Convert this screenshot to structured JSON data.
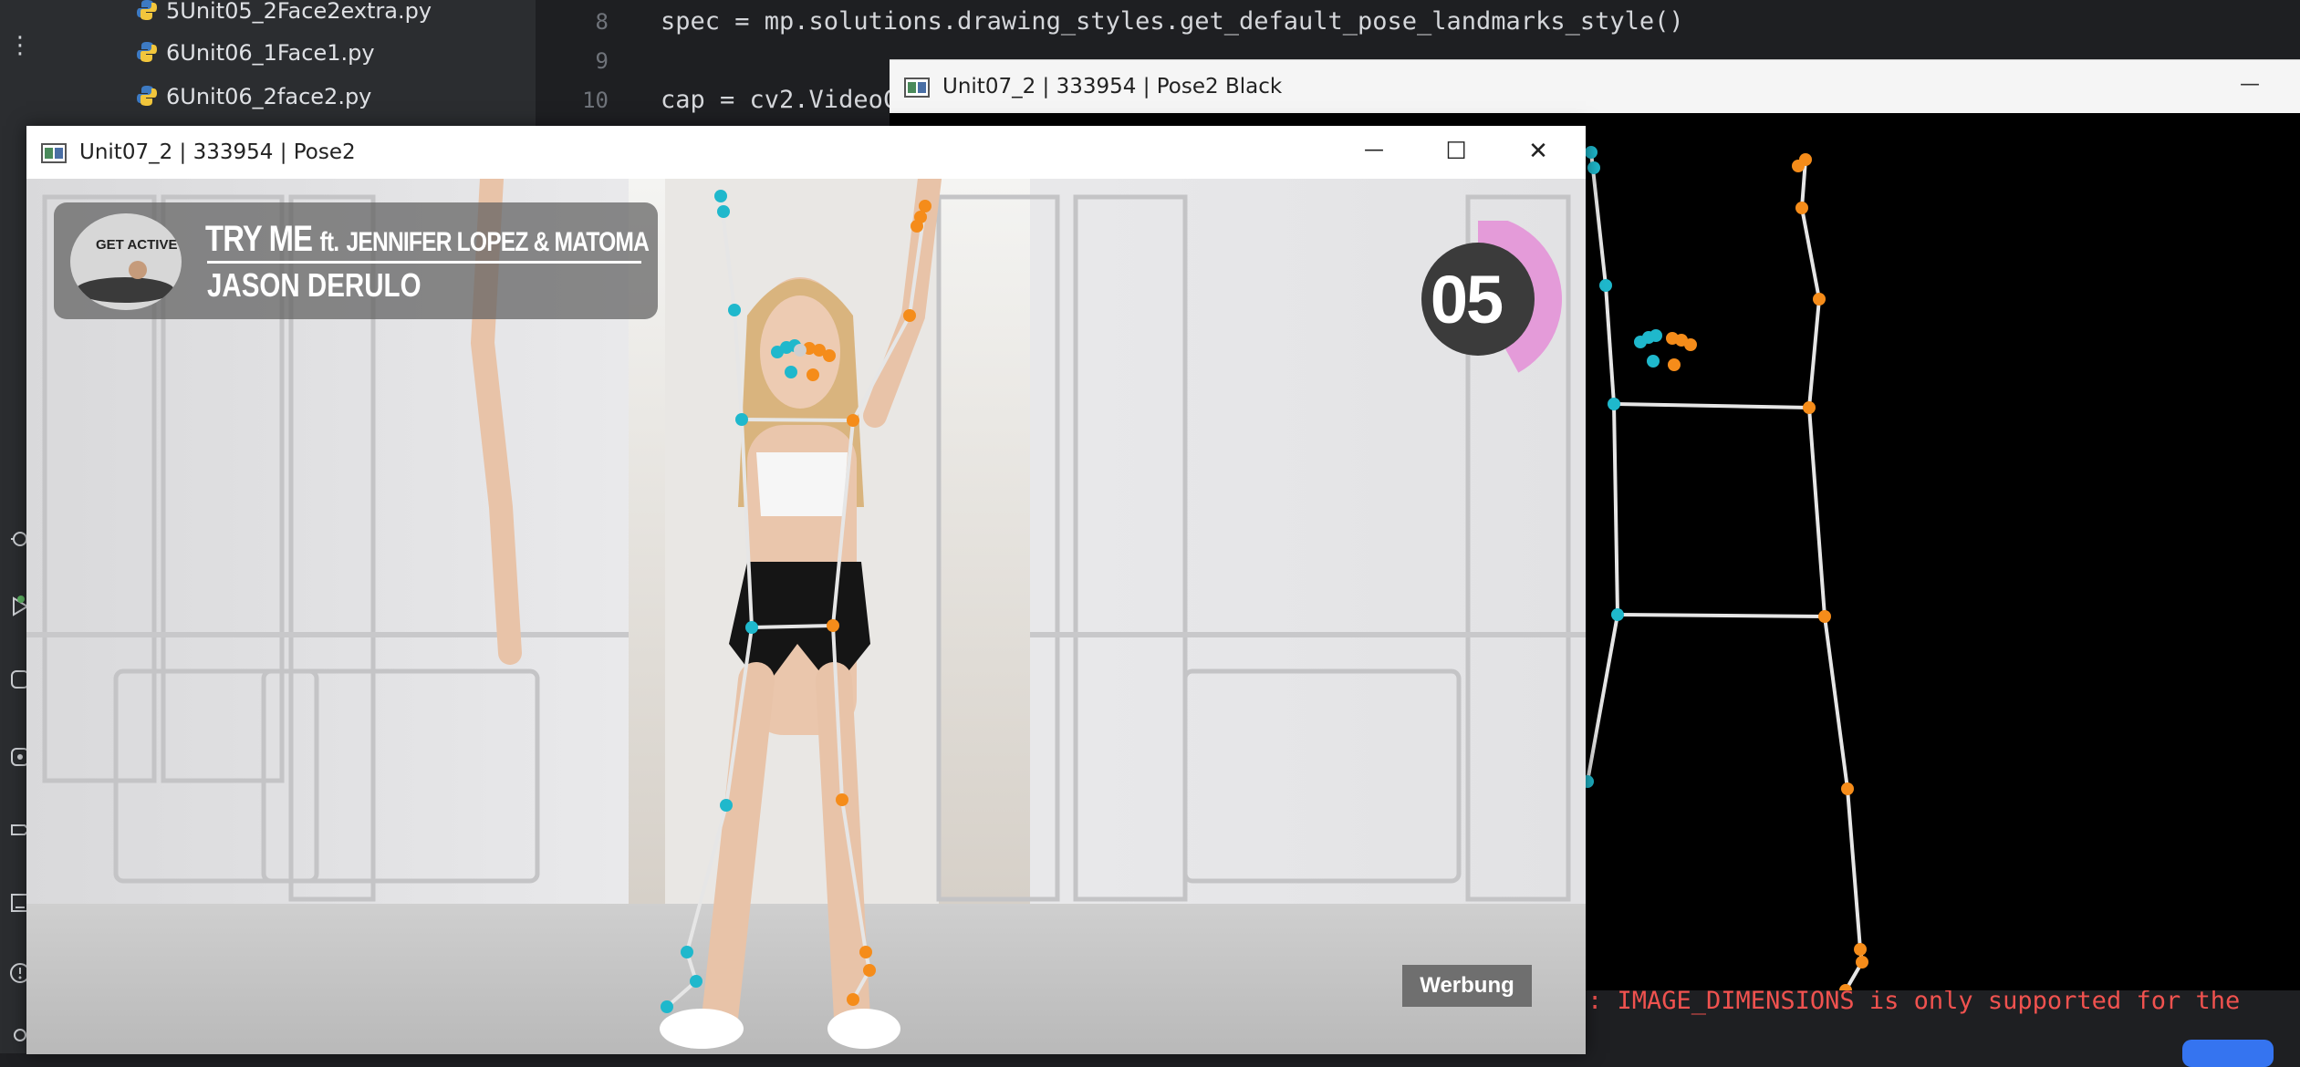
{
  "ide": {
    "files": [
      {
        "name": "5Unit05_2Face2extra.py"
      },
      {
        "name": "6Unit06_1Face1.py"
      },
      {
        "name": "6Unit06_2face2.py"
      }
    ],
    "code_lines": [
      {
        "line": "8",
        "text": "spec = mp.solutions.drawing_styles.get_default_pose_landmarks_style()"
      },
      {
        "line": "9",
        "text": ""
      },
      {
        "line": "10",
        "text": "cap = cv2.VideoC"
      }
    ],
    "console_text": ": IMAGE_DIMENSIONS is only supported for the",
    "more_menu_glyph": "⋮"
  },
  "black_window": {
    "title": "Unit07_2 | 333954 | Pose2 Black",
    "minimize_glyph": "—"
  },
  "main_window": {
    "title": "Unit07_2 | 333954 | Pose2",
    "minimize_glyph": "—",
    "maximize_glyph": "☐",
    "close_glyph": "✕",
    "overlay": {
      "thumb_label": "GET ACTIVE",
      "song": "TRY ME",
      "featuring": "ft.",
      "song_rest": "JENNIFER LOPEZ & MATOMA",
      "artist": "JASON DERULO"
    },
    "timer_value": "05",
    "timer_progress": 0.42,
    "ad_badge": "Werbung"
  },
  "colors": {
    "left_landmark": "#1fb8cc",
    "right_landmark": "#f58c1a",
    "connection": "#e6e6e6",
    "timer_ring": "#e49bd9",
    "timer_disc": "#3b3b3b"
  }
}
